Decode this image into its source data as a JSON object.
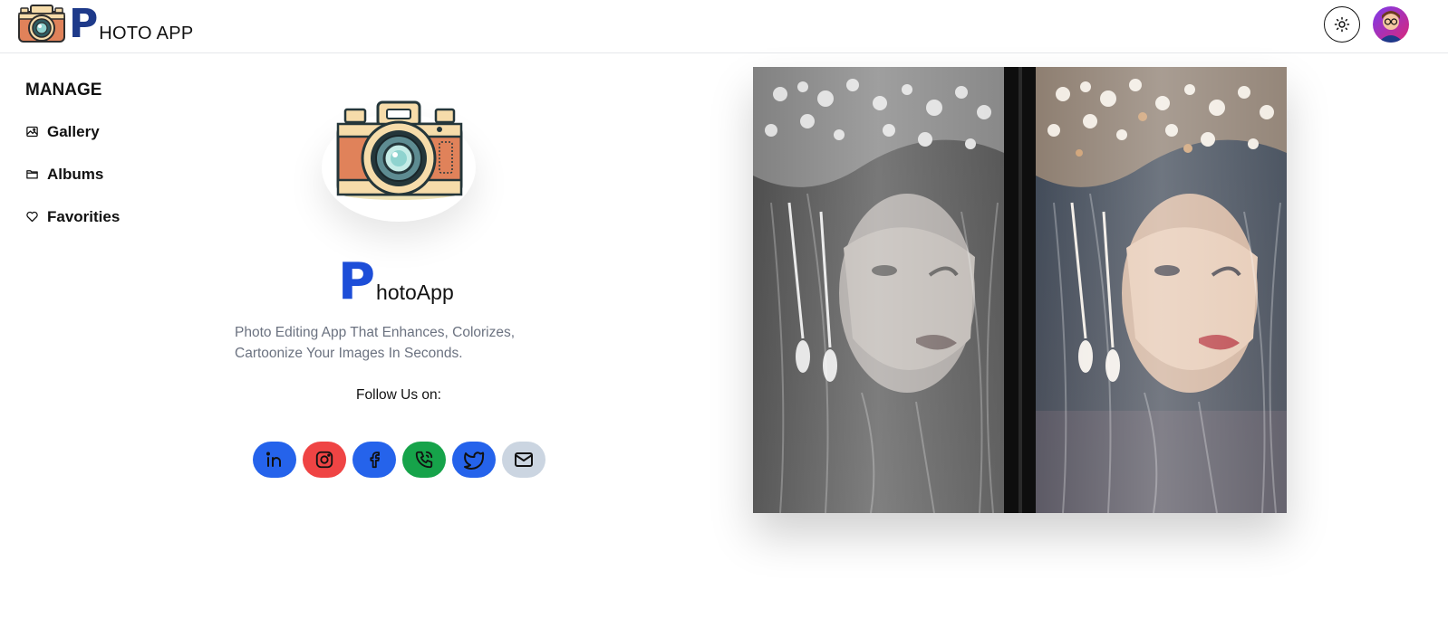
{
  "header": {
    "brand_initial": "P",
    "brand_rest": "HOTO APP",
    "theme_icon": "sun-icon",
    "avatar_icon": "avatar"
  },
  "sidebar": {
    "title": "MANAGE",
    "items": [
      {
        "label": "Gallery",
        "icon": "image-icon"
      },
      {
        "label": "Albums",
        "icon": "folder-icon"
      },
      {
        "label": "Favorities",
        "icon": "heart-icon"
      }
    ]
  },
  "main": {
    "app_initial": "P",
    "app_rest": "hotoApp",
    "tagline_line1": "Photo Editing App That Enhances, Colorizes,",
    "tagline_line2": "Cartoonize Your Images In Seconds.",
    "follow_label": "Follow Us on:",
    "socials": [
      {
        "name": "linkedin-icon",
        "color": "#2563eb"
      },
      {
        "name": "instagram-icon",
        "color": "#ef4444"
      },
      {
        "name": "facebook-icon",
        "color": "#2563eb"
      },
      {
        "name": "phone-icon",
        "color": "#16a34a"
      },
      {
        "name": "twitter-icon",
        "color": "#2563eb"
      },
      {
        "name": "mail-icon",
        "color": "#cbd5e1"
      }
    ]
  },
  "colors": {
    "brand_dark": "#1e3a8a",
    "brand_blue": "#1d4ed8",
    "muted_text": "#6b7280"
  }
}
